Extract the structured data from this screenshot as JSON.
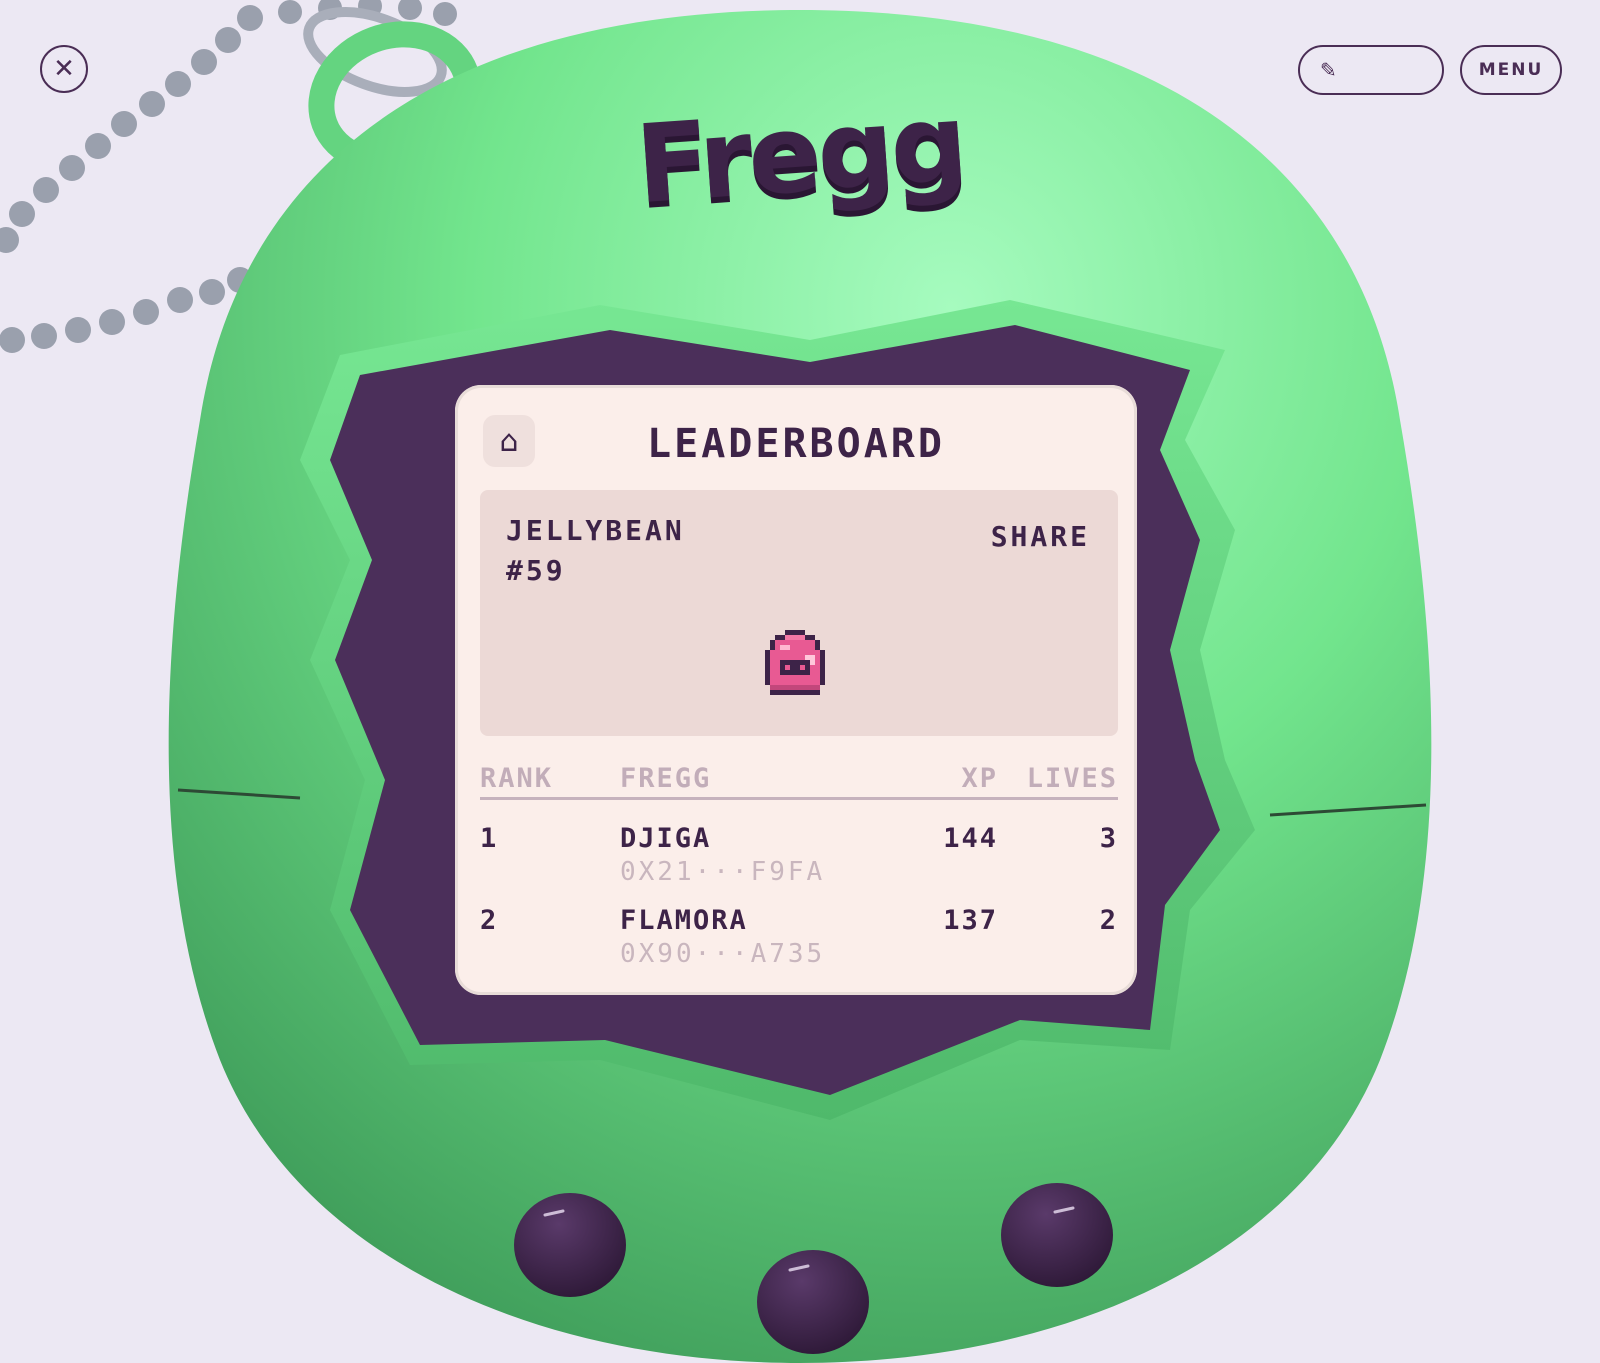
{
  "header": {
    "close_icon": "close-icon",
    "wallet_icon": "pen-icon",
    "menu_label": "MENU"
  },
  "device": {
    "brand": "Fregg",
    "color": "#6bdc85",
    "screen": {
      "title": "LEADERBOARD",
      "home_icon": "home-icon",
      "profile": {
        "name": "JELLYBEAN",
        "id": "#59",
        "share_label": "SHARE",
        "pet_icon": "pink-egg-pet-icon"
      },
      "columns": [
        "RANK",
        "FREGG",
        "XP",
        "LIVES"
      ],
      "rows": [
        {
          "rank": "1",
          "name": "DJIGA",
          "address": "0X21···F9FA",
          "xp": "144",
          "lives": "3"
        },
        {
          "rank": "2",
          "name": "FLAMORA",
          "address": "0X90···A735",
          "xp": "137",
          "lives": "2"
        }
      ]
    }
  },
  "colors": {
    "background": "#ece8f3",
    "shell_green": "#6bdc85",
    "screen_frame": "#4b2f5a",
    "screen_bg": "#fbeeea",
    "text_dark": "#3d2348",
    "text_muted": "#c2adb9"
  }
}
